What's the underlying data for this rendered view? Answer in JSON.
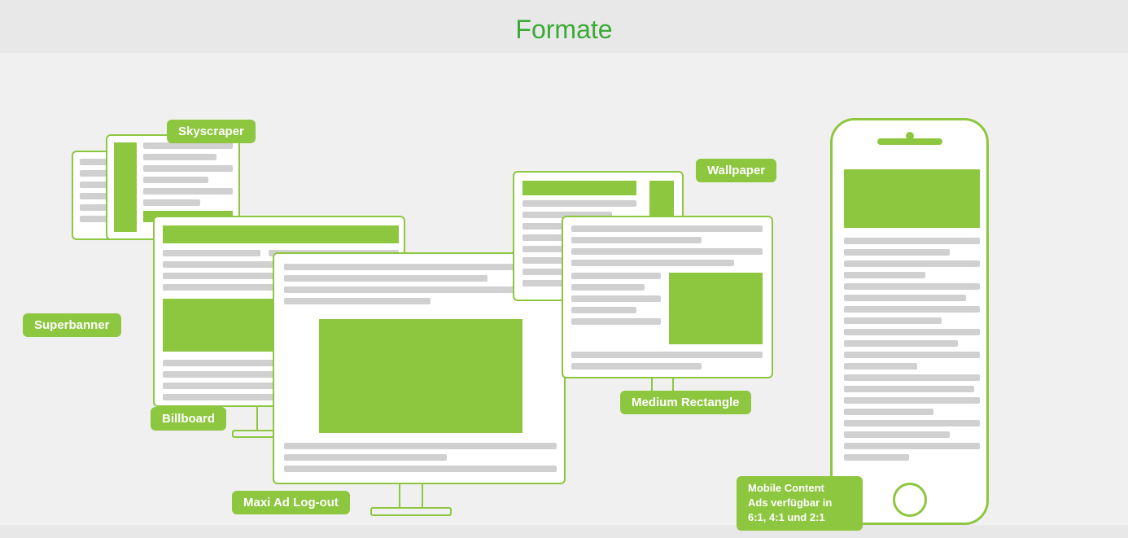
{
  "page": {
    "title": "Formate"
  },
  "labels": {
    "skyscraper": "Skyscraper",
    "wallpaper": "Wallpaper",
    "superbanner": "Superbanner",
    "billboard": "Billboard",
    "medium_rectangle": "Medium Rectangle",
    "maxi_ad_logout": "Maxi Ad Log-out",
    "mobile_content": "Mobile Content\nAds verfügbar in\n6:1, 4:1 und 2:1"
  }
}
